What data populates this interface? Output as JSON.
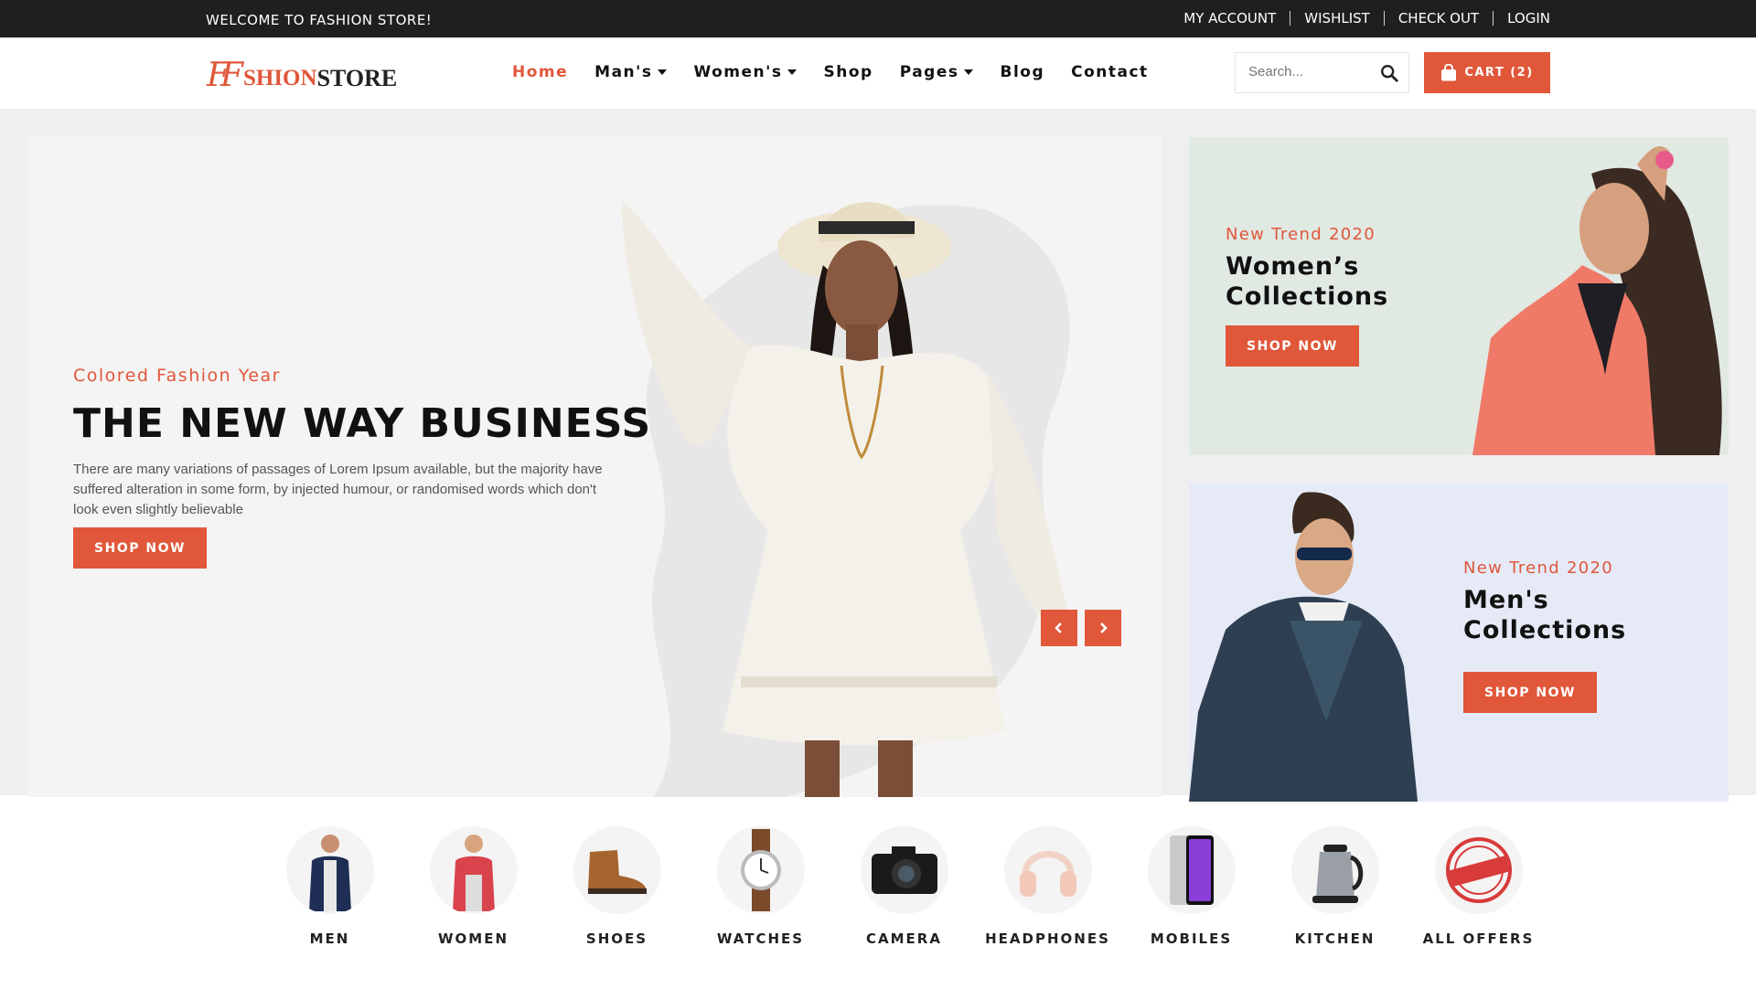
{
  "topbar": {
    "welcome": "WELCOME TO FASHION STORE!",
    "links": [
      "MY ACCOUNT",
      "WISHLIST",
      "CHECK OUT",
      "LOGIN"
    ]
  },
  "header": {
    "logo": {
      "ff": "FF",
      "part1": "SHION",
      "part2": "STORE"
    },
    "nav": [
      {
        "label": "Home",
        "active": true,
        "dropdown": false
      },
      {
        "label": "Man's",
        "active": false,
        "dropdown": true
      },
      {
        "label": "Women's",
        "active": false,
        "dropdown": true
      },
      {
        "label": "Shop",
        "active": false,
        "dropdown": false
      },
      {
        "label": "Pages",
        "active": false,
        "dropdown": true
      },
      {
        "label": "Blog",
        "active": false,
        "dropdown": false
      },
      {
        "label": "Contact",
        "active": false,
        "dropdown": false
      }
    ],
    "search_placeholder": "Search...",
    "cart_label": "CART (2)"
  },
  "slider": {
    "eyebrow": "Colored Fashion Year",
    "title": "THE NEW WAY BUSINESS",
    "description": "There are many variations of passages of Lorem Ipsum available, but the majority have suffered alteration in some form, by injected humour, or randomised words which don't look even slightly believable",
    "button": "SHOP NOW"
  },
  "banners": {
    "women": {
      "eyebrow": "New Trend 2020",
      "title": "Women’s Collections",
      "button": "SHOP NOW"
    },
    "men": {
      "eyebrow": "New Trend 2020",
      "title": "Men's Collections",
      "button": "SHOP NOW"
    }
  },
  "categories": [
    {
      "label": "MEN",
      "icon": "men-icon"
    },
    {
      "label": "WOMEN",
      "icon": "women-icon"
    },
    {
      "label": "SHOES",
      "icon": "shoes-icon"
    },
    {
      "label": "WATCHES",
      "icon": "watch-icon"
    },
    {
      "label": "CAMERA",
      "icon": "camera-icon"
    },
    {
      "label": "HEADPHONES",
      "icon": "headphones-icon"
    },
    {
      "label": "MOBILES",
      "icon": "mobile-icon"
    },
    {
      "label": "KITCHEN",
      "icon": "kettle-icon"
    },
    {
      "label": "ALL OFFERS",
      "icon": "special-offer-icon"
    }
  ],
  "colors": {
    "accent": "#e0573a",
    "topbar": "#1f1f1f",
    "women_banner": "#e1e9e3",
    "men_banner": "#e5eaf6"
  }
}
